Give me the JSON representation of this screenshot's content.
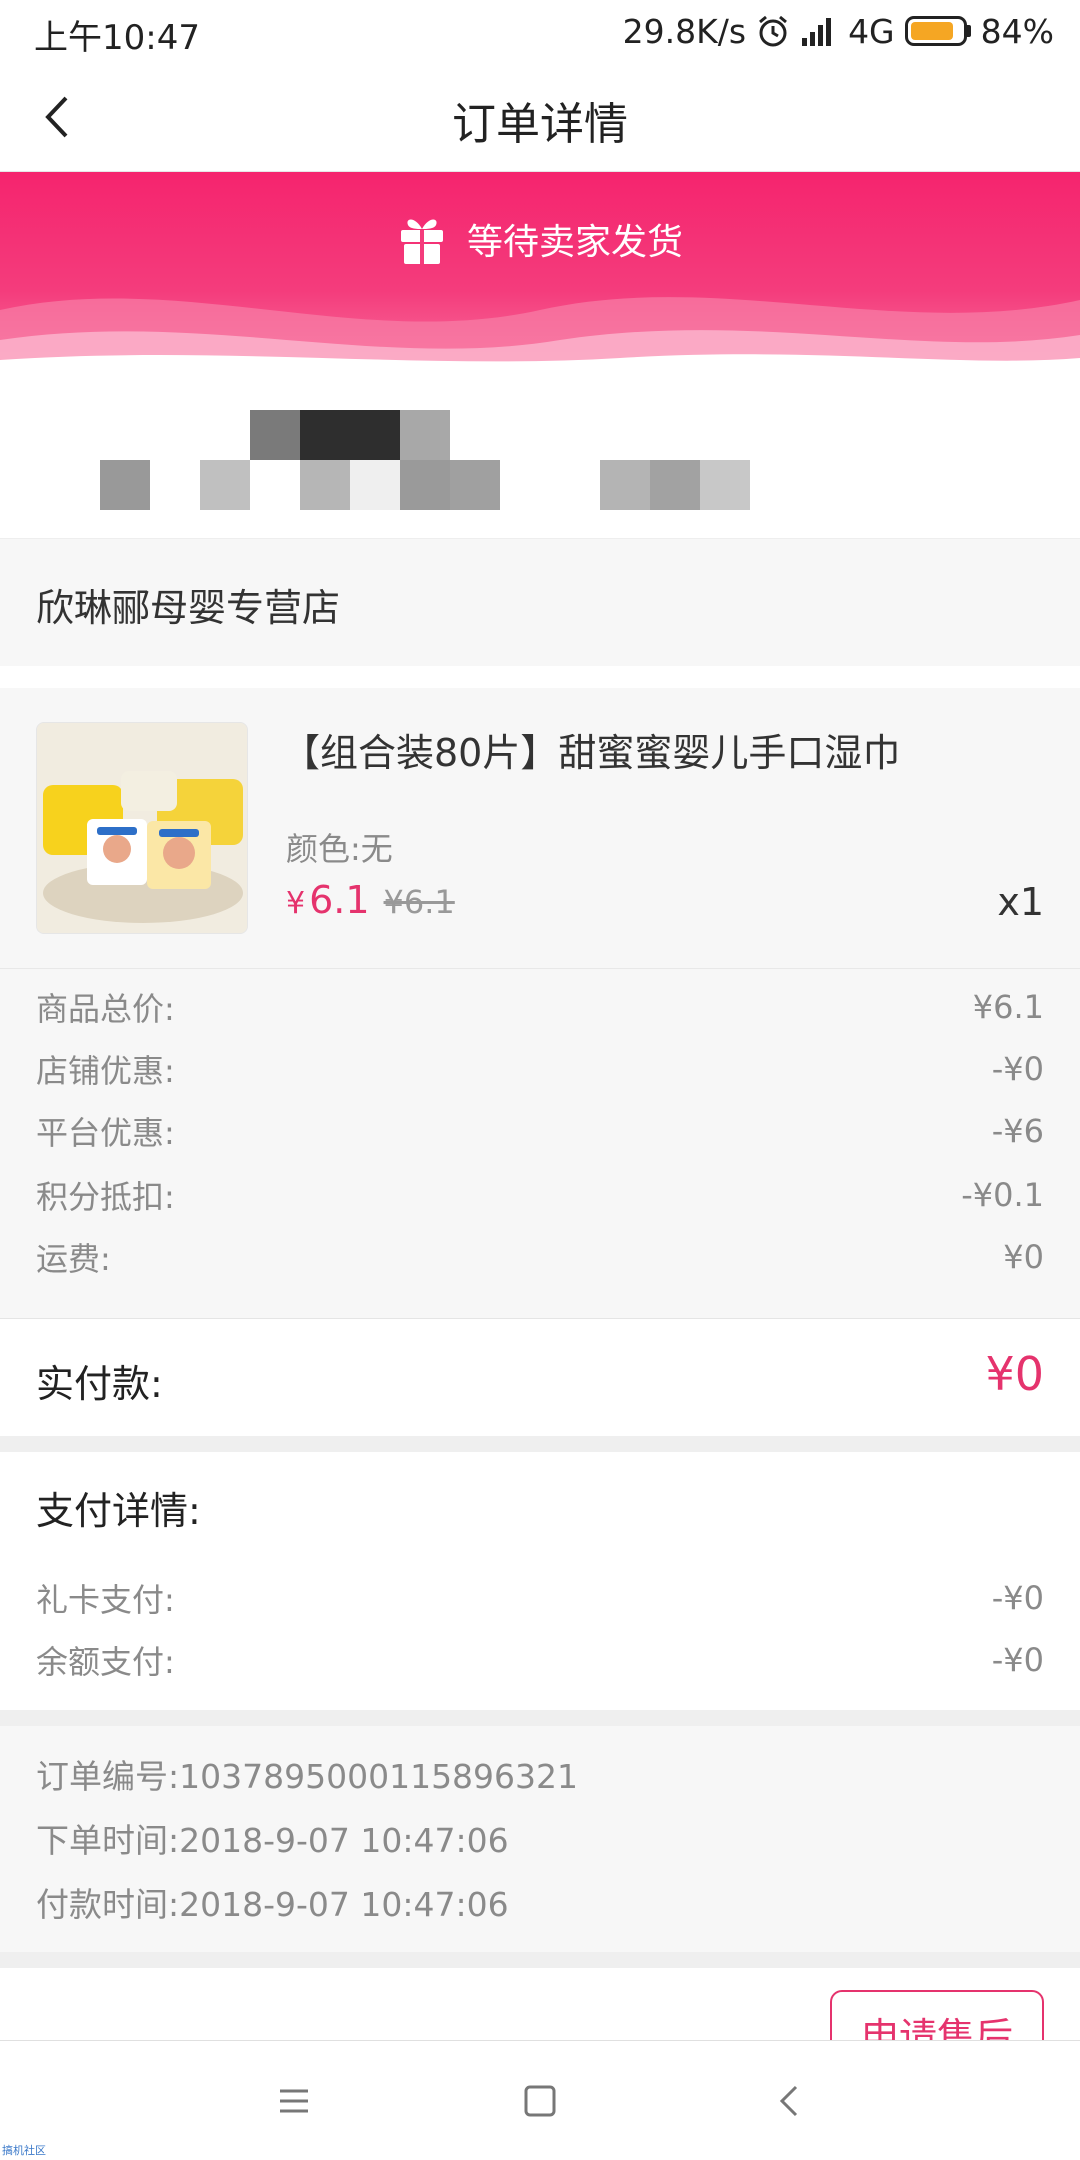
{
  "status_bar": {
    "time": "上午10:47",
    "net_speed": "29.8K/s",
    "network": "4G",
    "battery": "84%",
    "battery_level": 0.84
  },
  "nav": {
    "title": "订单详情",
    "back_icon": "chevron-left-icon"
  },
  "banner": {
    "status_text": "等待卖家发货",
    "icon": "gift-icon",
    "color": "#f5246e"
  },
  "shop": {
    "name": "欣琳郦母婴专营店"
  },
  "product": {
    "title": "【组合装80片】甜蜜蜜婴儿手口湿巾",
    "spec": "颜色:无",
    "price_symbol": "¥",
    "price": "6.1",
    "original_price": "¥6.1",
    "quantity": "x1"
  },
  "breakdown": [
    {
      "label": "商品总价:",
      "value": "¥6.1"
    },
    {
      "label": "店铺优惠:",
      "value": "-¥0"
    },
    {
      "label": "平台优惠:",
      "value": "-¥6"
    },
    {
      "label": "积分抵扣:",
      "value": "-¥0.1"
    },
    {
      "label": "运费:",
      "value": "¥0"
    }
  ],
  "paid": {
    "label": "实付款:",
    "amount": "¥0"
  },
  "payment_details": {
    "title": "支付详情:",
    "rows": [
      {
        "label": "礼卡支付:",
        "value": "-¥0"
      },
      {
        "label": "余额支付:",
        "value": "-¥0"
      }
    ]
  },
  "order_info": {
    "order_no": "订单编号:1037895000115896321",
    "order_time": "下单时间:2018-9-07 10:47:06",
    "pay_time": "付款时间:2018-9-07 10:47:06"
  },
  "actions": {
    "after_sale": "申请售后"
  },
  "watermark": "搞机社区",
  "accent_color": "#e5336d"
}
